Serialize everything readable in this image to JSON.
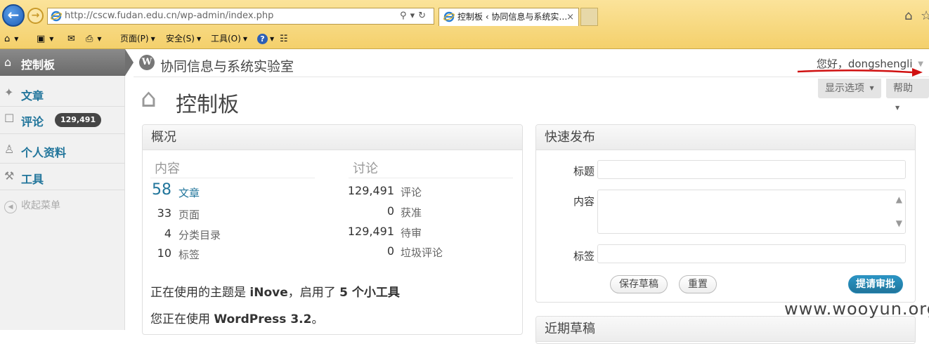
{
  "browser": {
    "url": "http://cscw.fudan.edu.cn/wp-admin/index.php",
    "tab_title": "控制板 ‹ 协同信息与系统实…",
    "tab_close": "×",
    "command_bar": {
      "page": "页面(P)",
      "safety": "安全(S)",
      "tools": "工具(O)"
    }
  },
  "sidebar": {
    "current": "控制板",
    "items": [
      {
        "label": "文章",
        "icon": "pin-icon"
      },
      {
        "label": "评论",
        "icon": "comment-icon",
        "badge": "129,491"
      },
      {
        "label": "个人资料",
        "icon": "users-icon"
      },
      {
        "label": "工具",
        "icon": "tools-icon"
      }
    ],
    "collapse": "收起菜单"
  },
  "header": {
    "site_title": "协同信息与系统实验室",
    "howdy": "您好，dongshengli"
  },
  "screen_options": "显示选项",
  "help": "帮助",
  "page_title": "控制板",
  "right_now": {
    "title": "概况",
    "content_heading": "内容",
    "discussion_heading": "讨论",
    "content": [
      {
        "num": "58",
        "label": "文章"
      },
      {
        "num": "33",
        "label": "页面"
      },
      {
        "num": "4",
        "label": "分类目录"
      },
      {
        "num": "10",
        "label": "标签"
      }
    ],
    "discussion": [
      {
        "num": "129,491",
        "label": "评论"
      },
      {
        "num": "0",
        "label": "获准"
      },
      {
        "num": "129,491",
        "label": "待审"
      },
      {
        "num": "0",
        "label": "垃圾评论"
      }
    ],
    "theme_prefix": "正在使用的主题是 ",
    "theme_name": "iNove",
    "theme_middle": "，启用了 ",
    "widgets": "5 个小工具",
    "wp_prefix": "您正在使用 ",
    "wp_version": "WordPress 3.2",
    "wp_suffix": "。"
  },
  "quick_press": {
    "title": "快速发布",
    "title_label": "标题",
    "content_label": "内容",
    "tags_label": "标签",
    "save_draft": "保存草稿",
    "reset": "重置",
    "submit": "提请审批"
  },
  "recent_drafts_partial": "近期草稿",
  "watermark": "www.wooyun.org"
}
